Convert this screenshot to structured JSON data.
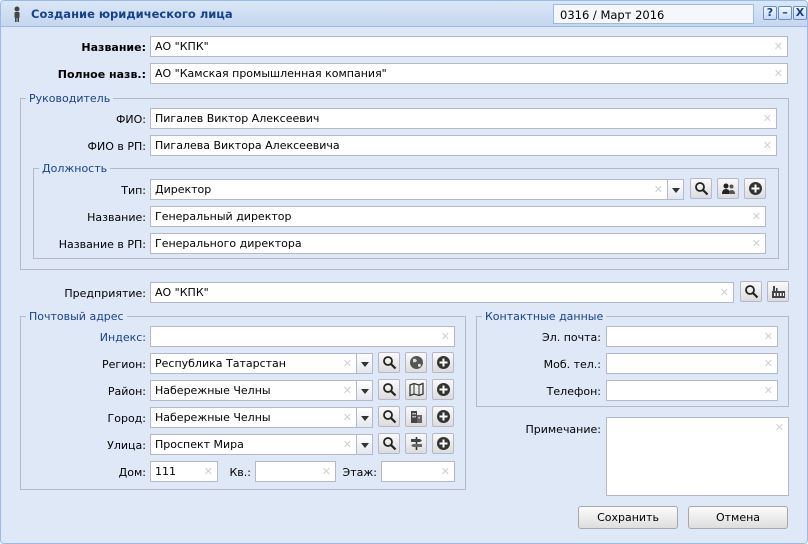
{
  "window": {
    "title": "Создание юридического лица",
    "period": "0316 / Март 2016",
    "help": "?",
    "minimize": "–",
    "close": "X"
  },
  "main": {
    "name_label": "Название:",
    "name_value": "АО \"КПК\"",
    "fullname_label": "Полное назв.:",
    "fullname_value": "АО \"Камская промышленная компания\""
  },
  "head": {
    "legend": "Руководитель",
    "fio_label": "ФИО:",
    "fio_value": "Пигалев Виктор Алексеевич",
    "fio_rp_label": "ФИО в РП:",
    "fio_rp_value": "Пигалева Виктора Алексеевича",
    "position": {
      "legend": "Должность",
      "type_label": "Тип:",
      "type_value": "Директор",
      "name_label": "Название:",
      "name_value": "Генеральный директор",
      "name_rp_label": "Название в РП:",
      "name_rp_value": "Генерального директора"
    }
  },
  "enterprise": {
    "label": "Предприятие:",
    "value": "АО \"КПК\""
  },
  "address": {
    "legend": "Почтовый адрес",
    "index_label": "Индекс:",
    "index_value": "",
    "region_label": "Регион:",
    "region_value": "Республика Татарстан",
    "district_label": "Район:",
    "district_value": "Набережные Челны",
    "city_label": "Город:",
    "city_value": "Набережные Челны",
    "street_label": "Улица:",
    "street_value": "Проспект Мира",
    "house_label": "Дом:",
    "house_value": "111",
    "flat_label": "Кв.:",
    "flat_value": "",
    "floor_label": "Этаж:",
    "floor_value": ""
  },
  "contacts": {
    "legend": "Контактные данные",
    "email_label": "Эл. почта:",
    "email_value": "",
    "mobile_label": "Моб. тел.:",
    "mobile_value": "",
    "phone_label": "Телефон:",
    "phone_value": ""
  },
  "note": {
    "label": "Примечание:",
    "value": ""
  },
  "actions": {
    "save": "Сохранить",
    "cancel": "Отмена"
  },
  "icons": {
    "title": "person-icon",
    "search": "search-icon",
    "add": "plus-circle-icon",
    "employees": "users-icon",
    "factory": "factory-icon",
    "globe": "globe-icon",
    "map": "map-icon",
    "building": "building-icon",
    "signpost": "signpost-icon"
  },
  "colors": {
    "title_text": "#15428b",
    "window_bg": "#dfe8f6",
    "border": "#99bbe8"
  }
}
